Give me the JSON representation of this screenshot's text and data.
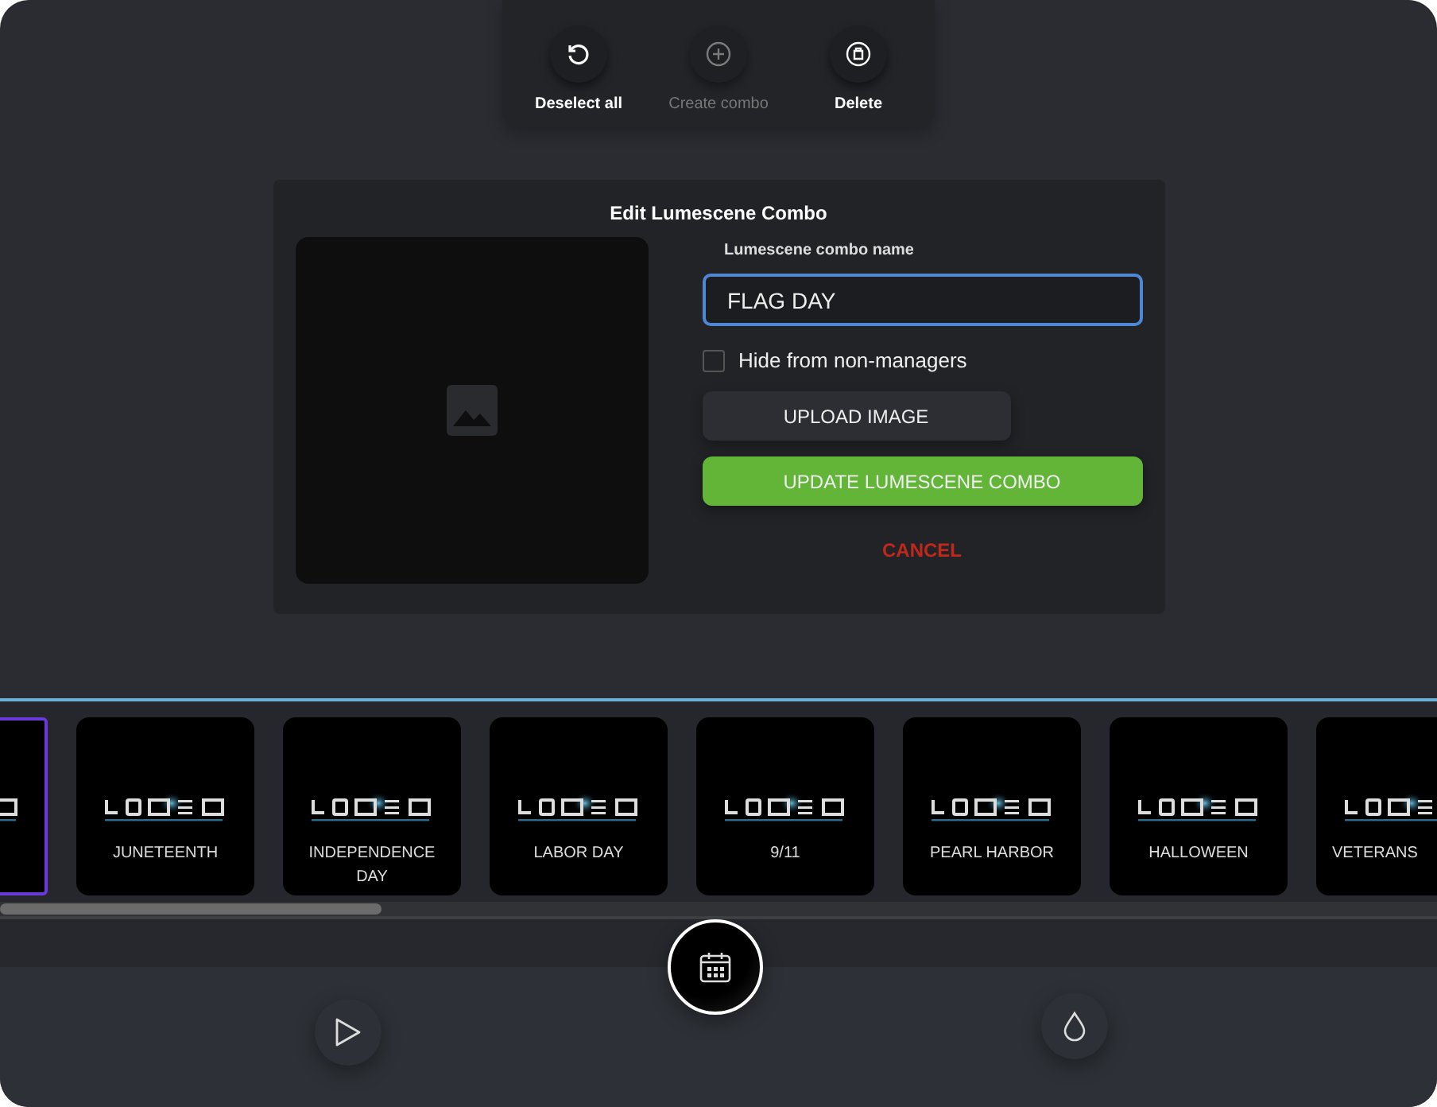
{
  "toolbar": [
    {
      "kind": "deselect",
      "label": "Deselect all",
      "disabled": false
    },
    {
      "kind": "create",
      "label": "Create combo",
      "disabled": true
    },
    {
      "kind": "delete",
      "label": "Delete",
      "disabled": false
    }
  ],
  "dialog": {
    "title": "Edit Lumescene Combo",
    "name_label": "Lumescene combo name",
    "name_value": "FLAG DAY",
    "hide_checkbox": {
      "label": "Hide from non-managers",
      "checked": false
    },
    "upload_button": "UPLOAD IMAGE",
    "update_button": "UPDATE LUMESCENE COMBO",
    "cancel_button": "CANCEL"
  },
  "scenes": [
    {
      "selected": true
    },
    {
      "label": "JUNETEENTH",
      "selected": false
    },
    {
      "label": "INDEPENDENCE DAY",
      "selected": false
    },
    {
      "label": "LABOR DAY",
      "selected": false
    },
    {
      "label": "9/11",
      "selected": false
    },
    {
      "label": "PEARL HARBOR",
      "selected": false
    },
    {
      "label": "HALLOWEEN",
      "selected": false
    },
    {
      "label": "VETERANS",
      "selected": false
    }
  ],
  "bottom_nav": [
    {
      "kind": "play",
      "selected": false
    },
    {
      "kind": "calendar",
      "selected": true
    },
    {
      "kind": "drop",
      "selected": false
    }
  ]
}
